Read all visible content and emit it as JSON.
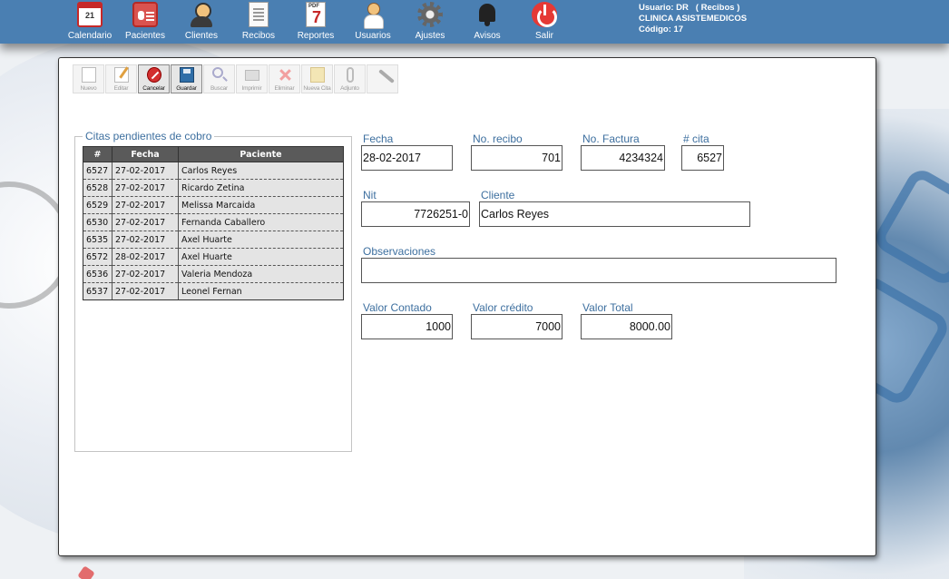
{
  "nav": [
    {
      "label": "Calendario",
      "icon": "calendar-icon",
      "badge": "21"
    },
    {
      "label": "Pacientes",
      "icon": "patients-icon"
    },
    {
      "label": "Clientes",
      "icon": "clients-icon"
    },
    {
      "label": "Recibos",
      "icon": "receipts-icon"
    },
    {
      "label": "Reportes",
      "icon": "reports-pdf-icon"
    },
    {
      "label": "Usuarios",
      "icon": "users-icon"
    },
    {
      "label": "Ajustes",
      "icon": "gear-icon"
    },
    {
      "label": "Avisos",
      "icon": "bell-icon"
    },
    {
      "label": "Salir",
      "icon": "power-icon"
    }
  ],
  "user": {
    "line1": "Usuario: DR   ( Recibos )",
    "line2": "CLINICA ASISTEMEDICOS",
    "line3": "Código: 17"
  },
  "toolbar": [
    {
      "label": "Nuevo",
      "icon": "new-document-icon"
    },
    {
      "label": "Editar",
      "icon": "edit-icon"
    },
    {
      "label": "Cancelar",
      "icon": "cancel-icon"
    },
    {
      "label": "Guardar",
      "icon": "save-icon"
    },
    {
      "label": "Buscar",
      "icon": "search-icon"
    },
    {
      "label": "Imprimir",
      "icon": "printer-icon"
    },
    {
      "label": "Eliminar",
      "icon": "delete-icon"
    },
    {
      "label": "Nueva Cita",
      "icon": "new-appointment-icon"
    },
    {
      "label": "Adjunto",
      "icon": "paperclip-icon"
    },
    {
      "label": "",
      "icon": "pen-icon"
    }
  ],
  "pending": {
    "title": "Citas pendientes de cobro",
    "columns": [
      "#",
      "Fecha",
      "Paciente"
    ],
    "rows": [
      [
        "6527",
        "27-02-2017",
        "Carlos Reyes"
      ],
      [
        "6528",
        "27-02-2017",
        "Ricardo Zetina"
      ],
      [
        "6529",
        "27-02-2017",
        "Melissa Marcaida"
      ],
      [
        "6530",
        "27-02-2017",
        "Fernanda Caballero"
      ],
      [
        "6535",
        "27-02-2017",
        "Axel Huarte"
      ],
      [
        "6572",
        "28-02-2017",
        "Axel Huarte"
      ],
      [
        "6536",
        "27-02-2017",
        "Valeria Mendoza"
      ],
      [
        "6537",
        "27-02-2017",
        "Leonel Fernan"
      ]
    ]
  },
  "form": {
    "fecha": {
      "label": "Fecha",
      "value": "28-02-2017"
    },
    "recibo": {
      "label": "No. recibo",
      "value": "701"
    },
    "factura": {
      "label": "No. Factura",
      "value": "4234324"
    },
    "cita": {
      "label": "# cita",
      "value": "6527"
    },
    "nit": {
      "label": "Nit",
      "value": "7726251-0"
    },
    "cliente": {
      "label": "Cliente",
      "value": "Carlos Reyes"
    },
    "observaciones": {
      "label": "Observaciones",
      "value": ""
    },
    "contado": {
      "label": "Valor Contado",
      "value": "1000"
    },
    "credito": {
      "label": "Valor crédito",
      "value": "7000"
    },
    "total": {
      "label": "Valor Total",
      "value": "8000.00"
    }
  },
  "colors": {
    "topbar": "#4a7fb2",
    "label": "#3d6f9f",
    "header": "#5a5a5a"
  }
}
